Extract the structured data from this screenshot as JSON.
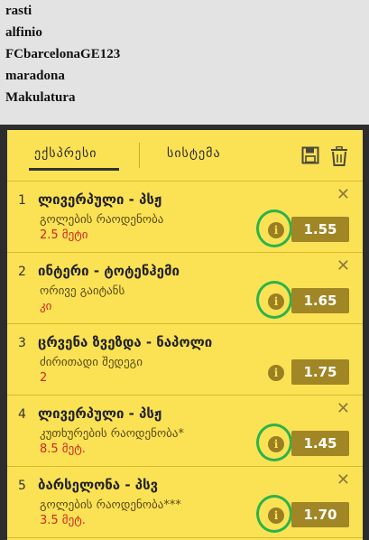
{
  "usernames": [
    "rasti",
    "alfinio",
    "FCbarcelonaGE123",
    "maradona",
    "Makulatura"
  ],
  "betslip": {
    "tabs": [
      {
        "label": "ექსპრესი",
        "active": true
      },
      {
        "label": "სისტემა",
        "active": false
      }
    ],
    "icons": {
      "save": "save-icon",
      "trash": "trash-icon",
      "info": "info-icon",
      "close": "close-icon"
    },
    "accent_color": "#fbe255",
    "odds_bg_color": "#a18626",
    "highlight_color": "#2bb34a",
    "bets": [
      {
        "index": "1",
        "teams": "ლივერპული - პსჟ",
        "market": "გოლების რაოდენობა",
        "pick": "2.5 მეტი",
        "odds": "1.55",
        "highlighted": true
      },
      {
        "index": "2",
        "teams": "ინტერი - ტოტენჰემი",
        "market": "ორივე გაიტანს",
        "pick": "კი",
        "odds": "1.65",
        "highlighted": true
      },
      {
        "index": "3",
        "teams": "ცრვენა ზვეზდა - ნაპოლი",
        "market": "ძირითადი შედეგი",
        "pick": "2",
        "odds": "1.75",
        "highlighted": false
      },
      {
        "index": "4",
        "teams": "ლივერპული - პსჟ",
        "market": "კუთხურების რაოდენობა*",
        "pick": "8.5 მეტ.",
        "odds": "1.45",
        "highlighted": true
      },
      {
        "index": "5",
        "teams": "ბარსელონა - პსვ",
        "market": "გოლების რაოდენობა***",
        "pick": "3.5 მეტ.",
        "odds": "1.70",
        "highlighted": true
      }
    ]
  }
}
